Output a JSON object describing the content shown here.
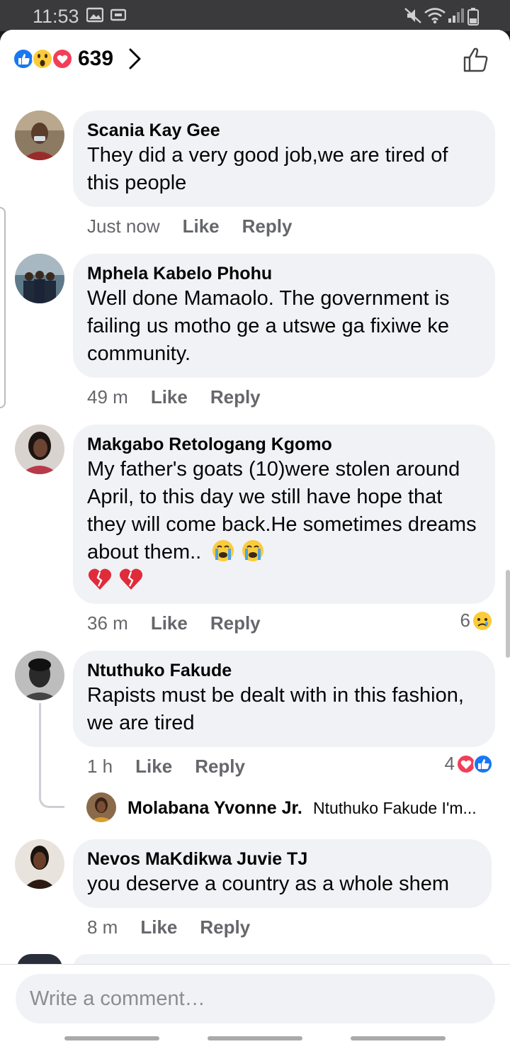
{
  "status_bar": {
    "time": "11:53"
  },
  "header": {
    "reaction_count": "639",
    "reaction_icons": [
      "like-icon",
      "wow-icon",
      "love-icon"
    ]
  },
  "comments": [
    {
      "author": "Scania Kay Gee",
      "text": "They did a very good job,we are tired of this people",
      "time": "Just now",
      "like": "Like",
      "reply": "Reply"
    },
    {
      "author": "Mphela Kabelo Phohu",
      "text": "Well done Mamaolo. The government is failing us motho ge a utswe ga fixiwe ke community.",
      "time": "49 m",
      "like": "Like",
      "reply": "Reply"
    },
    {
      "author": "Makgabo Retologang Kgomo",
      "text": "My father's goats (10)were stolen around April, to this day we still have hope that they will come back.He sometimes dreams about them..",
      "time": "36 m",
      "like": "Like",
      "reply": "Reply",
      "reaction_count": "6",
      "reaction_icons": [
        "sad-icon"
      ]
    },
    {
      "author": "Ntuthuko Fakude",
      "text": "Rapists must be dealt with in this fashion, we are tired",
      "time": "1 h",
      "like": "Like",
      "reply": "Reply",
      "reaction_count": "4",
      "reaction_icons": [
        "love-icon",
        "like-icon"
      ]
    },
    {
      "author": "Nevos MaKdikwa Juvie TJ",
      "text": "you deserve a country as a whole shem",
      "time": "8 m",
      "like": "Like",
      "reply": "Reply"
    }
  ],
  "reply_preview": {
    "author": "Molabana Yvonne Jr.",
    "snippet": "Ntuthuko Fakude I'm..."
  },
  "composer": {
    "placeholder": "Write a comment…"
  }
}
